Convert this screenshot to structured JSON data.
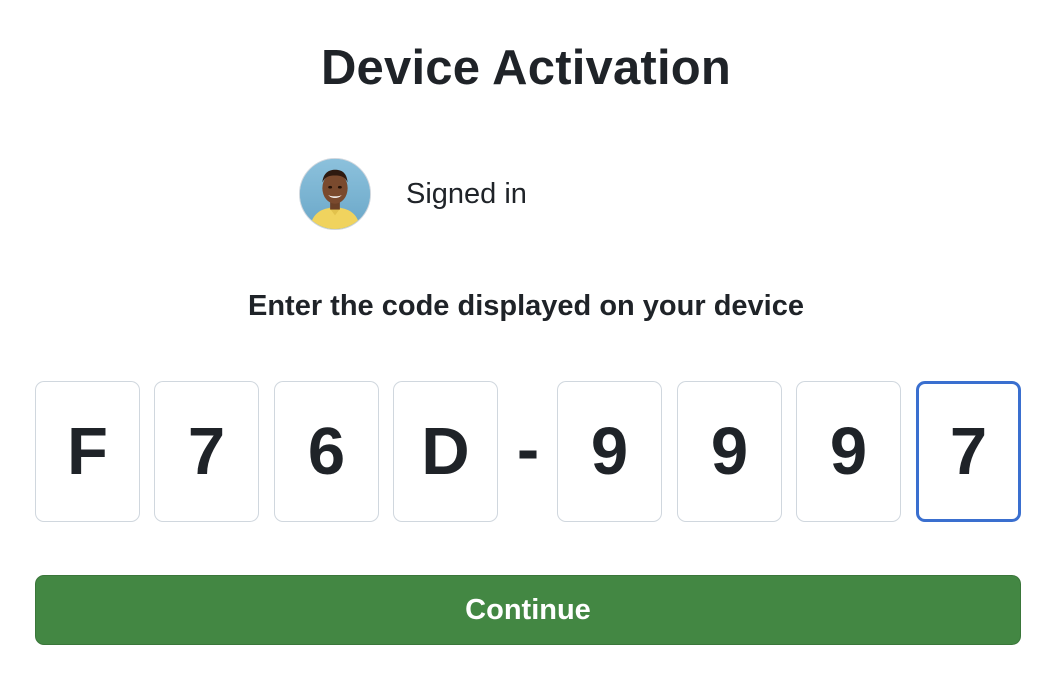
{
  "page": {
    "title": "Device Activation"
  },
  "account": {
    "status": "Signed in",
    "avatar_icon": "user-avatar-photo"
  },
  "prompt": "Enter the code displayed on your device",
  "code": {
    "characters": [
      "F",
      "7",
      "6",
      "D",
      "9",
      "9",
      "9",
      "7"
    ],
    "separator": "-",
    "focused_index": 7
  },
  "continue_label": "Continue",
  "colors": {
    "primary_button": "#438743",
    "focus_border": "#3a6fcf",
    "input_border": "#d0d7de",
    "text": "#1f2328"
  }
}
